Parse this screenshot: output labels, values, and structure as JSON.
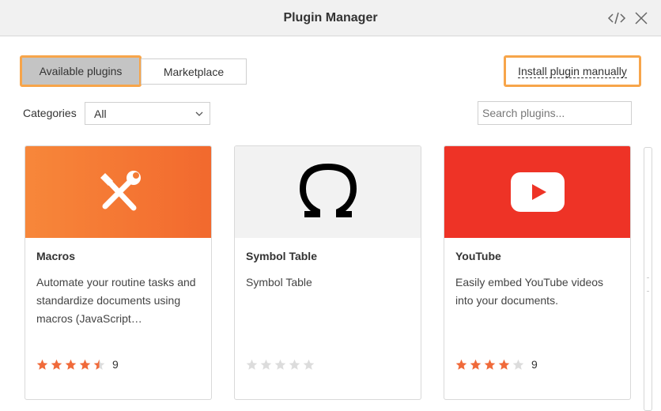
{
  "window": {
    "title": "Plugin Manager",
    "icons": [
      "code-icon",
      "close-icon"
    ]
  },
  "tabs": {
    "available": "Available plugins",
    "marketplace": "Marketplace",
    "active": "available",
    "highlight_color": "#f7a54a"
  },
  "install_manually": "Install plugin manually",
  "filters": {
    "categories_label": "Categories",
    "categories_value": "All",
    "search_placeholder": "Search plugins..."
  },
  "plugins": [
    {
      "name": "Macros",
      "description": "Automate your routine tasks and standardize documents using macros (JavaScript…",
      "rating": 4.5,
      "reviews": "9",
      "banner_color": "#f47b35",
      "icon": "tools-icon"
    },
    {
      "name": "Symbol Table",
      "description": "Symbol Table",
      "rating": 0,
      "reviews": "",
      "banner_color": "#f2f2f2",
      "icon": "omega-icon"
    },
    {
      "name": "YouTube",
      "description": "Easily embed YouTube videos into your documents.",
      "rating": 4,
      "reviews": "9",
      "banner_color": "#ee3326",
      "icon": "youtube-play-icon"
    }
  ],
  "star_colors": {
    "filled": "#f06a3a",
    "empty": "#dcdcdc"
  }
}
